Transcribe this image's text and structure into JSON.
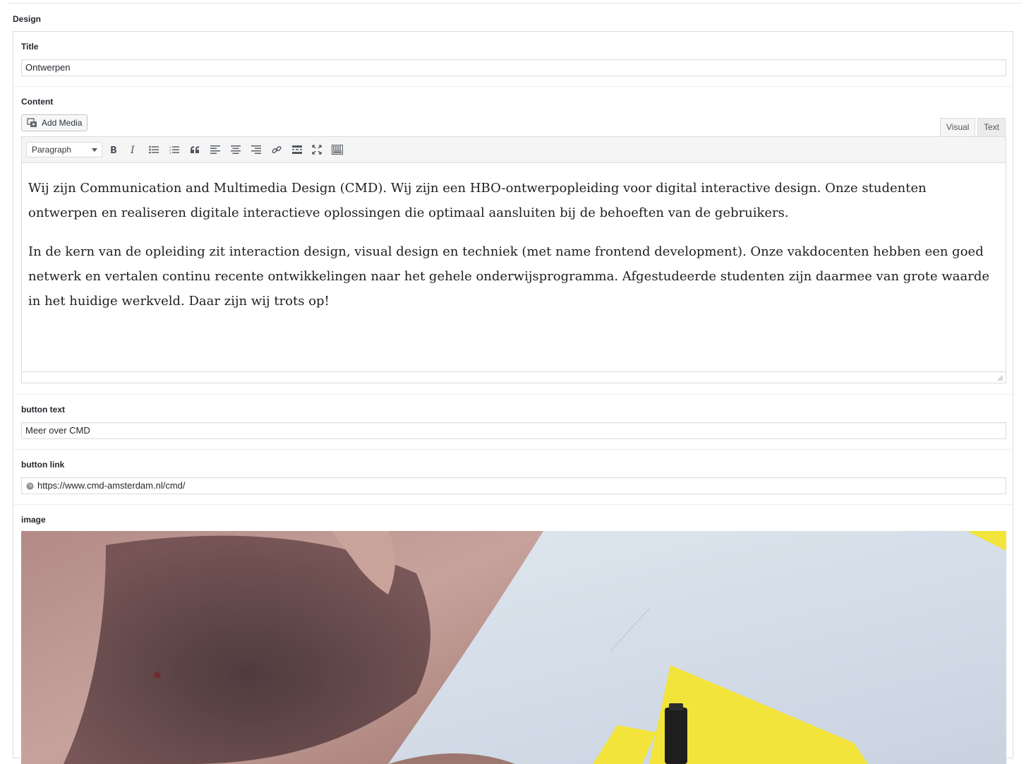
{
  "section": {
    "label": "Design"
  },
  "title_field": {
    "label": "Title",
    "value": "Ontwerpen"
  },
  "content_field": {
    "label": "Content",
    "add_media_label": "Add Media",
    "tabs": [
      {
        "label": "Visual",
        "active": true
      },
      {
        "label": "Text",
        "active": false
      }
    ],
    "format_select": "Paragraph",
    "toolbar_icons": [
      "bold-icon",
      "italic-icon",
      "bullet-list-icon",
      "numbered-list-icon",
      "blockquote-icon",
      "align-left-icon",
      "align-center-icon",
      "align-right-icon",
      "link-icon",
      "read-more-icon",
      "fullscreen-icon",
      "toolbar-toggle-icon"
    ],
    "paragraphs": [
      "Wij zijn Communication and Multimedia Design (CMD). Wij zijn een HBO-ontwerpopleiding voor digital interactive design. Onze studenten ontwerpen en realiseren digitale interactieve oplossingen die optimaal aansluiten bij de behoeften van de gebruikers.",
      "In de kern van de opleiding zit interaction design, visual design en techniek (met name frontend development). Onze vakdocenten hebben een goed netwerk en vertalen continu recente ontwikkelingen naar het gehele onderwijsprogramma. Afgestudeerde studenten zijn daarmee van grote waarde in het huidige werkveld. Daar zijn wij trots op!"
    ]
  },
  "button_text_field": {
    "label": "button text",
    "value": "Meer over CMD"
  },
  "button_link_field": {
    "label": "button link",
    "value": "https://www.cmd-amsterdam.nl/cmd/",
    "icon": "globe-icon"
  },
  "image_field": {
    "label": "image",
    "alt_semantic": "photo-person-drawing-with-marker"
  },
  "colors": {
    "border": "#dcdcde",
    "toolbar_bg": "#f5f5f5",
    "text": "#23282d",
    "marker_yellow": "#f2e43a"
  }
}
